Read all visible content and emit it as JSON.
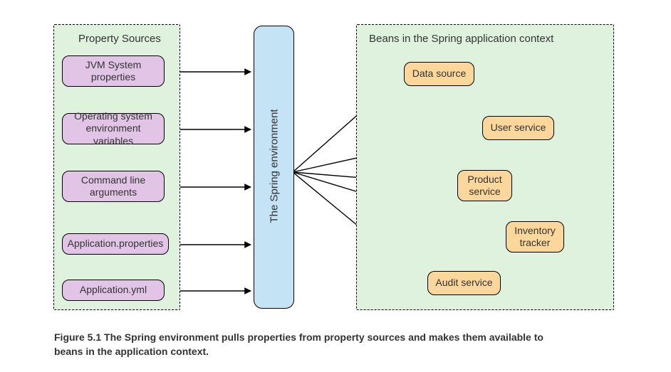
{
  "left_panel": {
    "title": "Property Sources"
  },
  "right_panel": {
    "title": "Beans in the Spring application context"
  },
  "env": {
    "label": "The Spring environment"
  },
  "sources": [
    {
      "label": "JVM System properties"
    },
    {
      "label": "Operating system environment variables"
    },
    {
      "label": "Command line arguments"
    },
    {
      "label": "Application.properties"
    },
    {
      "label": "Application.yml"
    }
  ],
  "beans": [
    {
      "label": "Data source"
    },
    {
      "label": "User service"
    },
    {
      "label": "Product service"
    },
    {
      "label": "Inventory tracker"
    },
    {
      "label": "Audit service"
    }
  ],
  "caption": "Figure 5.1   The Spring environment pulls properties from property sources and makes them available to beans in the application context."
}
